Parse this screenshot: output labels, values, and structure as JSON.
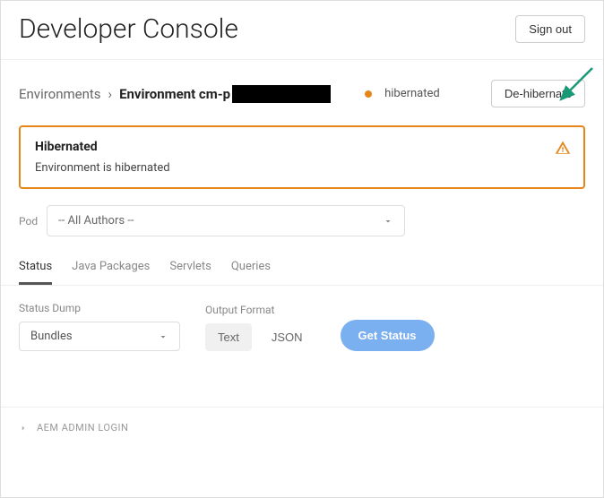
{
  "header": {
    "title": "Developer Console",
    "signout_label": "Sign out"
  },
  "breadcrumb": {
    "root": "Environments",
    "separator": "›",
    "current_prefix": "Environment cm-p"
  },
  "env_status": {
    "label": "hibernated",
    "action_label": "De-hibernate"
  },
  "alert": {
    "title": "Hibernated",
    "message": "Environment is hibernated"
  },
  "pod": {
    "label": "Pod",
    "selected": "-- All Authors --"
  },
  "tabs": [
    {
      "label": "Status",
      "active": true
    },
    {
      "label": "Java Packages",
      "active": false
    },
    {
      "label": "Servlets",
      "active": false
    },
    {
      "label": "Queries",
      "active": false
    }
  ],
  "status_dump": {
    "label": "Status Dump",
    "selected": "Bundles"
  },
  "output_format": {
    "label": "Output Format",
    "options": [
      "Text",
      "JSON"
    ]
  },
  "get_status_label": "Get Status",
  "admin_link": "AEM ADMIN LOGIN"
}
